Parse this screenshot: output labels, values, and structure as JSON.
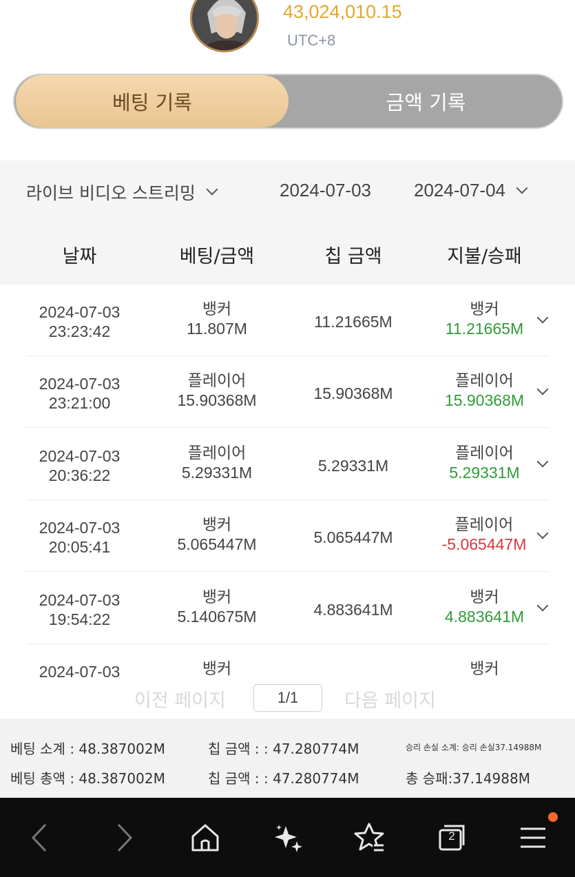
{
  "header": {
    "balance": "43,024,010.15",
    "timezone": "UTC+8"
  },
  "tabs": [
    {
      "label": "베팅 기록",
      "active": true
    },
    {
      "label": "금액 기록",
      "active": false
    }
  ],
  "filters": {
    "category": "라이브 비디오 스트리밍",
    "date_from": "2024-07-03",
    "date_to": "2024-07-04"
  },
  "table": {
    "columns": [
      "날짜",
      "베팅/금액",
      "칩 금액",
      "지불/승패"
    ],
    "rows": [
      {
        "date": "2024-07-03",
        "time": "23:23:42",
        "bet_type": "뱅커",
        "bet_amount": "11.807M",
        "chip": "11.21665M",
        "result_type": "뱅커",
        "result_amount": "11.21665M",
        "status": "win"
      },
      {
        "date": "2024-07-03",
        "time": "23:21:00",
        "bet_type": "플레이어",
        "bet_amount": "15.90368M",
        "chip": "15.90368M",
        "result_type": "플레이어",
        "result_amount": "15.90368M",
        "status": "win"
      },
      {
        "date": "2024-07-03",
        "time": "20:36:22",
        "bet_type": "플레이어",
        "bet_amount": "5.29331M",
        "chip": "5.29331M",
        "result_type": "플레이어",
        "result_amount": "5.29331M",
        "status": "win"
      },
      {
        "date": "2024-07-03",
        "time": "20:05:41",
        "bet_type": "뱅커",
        "bet_amount": "5.065447M",
        "chip": "5.065447M",
        "result_type": "플레이어",
        "result_amount": "-5.065447M",
        "status": "loss"
      },
      {
        "date": "2024-07-03",
        "time": "19:54:22",
        "bet_type": "뱅커",
        "bet_amount": "5.140675M",
        "chip": "4.883641M",
        "result_type": "뱅커",
        "result_amount": "4.883641M",
        "status": "win"
      },
      {
        "date": "2024-07-03",
        "time": "",
        "bet_type": "뱅커",
        "bet_amount": "",
        "chip": "",
        "result_type": "뱅커",
        "result_amount": "",
        "status": "win"
      }
    ]
  },
  "pager": {
    "prev": "이전 페이지",
    "page": "1/1",
    "next": "다음 페이지"
  },
  "summary": {
    "bet_subtotal": "베팅 소계 : 48.387002M",
    "chip_subtotal": "칩 금액 : : 47.280774M",
    "winloss_subtotal": "승리 손실 소계: 승리 손실37.14988M",
    "bet_total": "베팅 총액 : 48.387002M",
    "chip_total": "칩 금액 : : 47.280774M",
    "winloss_total": "총 승패:37.14988M"
  },
  "navbar": {
    "icons": [
      "back-icon",
      "forward-icon",
      "home-icon",
      "sparkle-icon",
      "bookmark-star-icon",
      "tabs-icon",
      "menu-icon"
    ],
    "tab_count": "2",
    "badge_color": "#f56a2c"
  },
  "colors": {
    "accent_gold": "#e3a82a",
    "win_green": "#2e9b3a",
    "loss_red": "#d9363e"
  }
}
